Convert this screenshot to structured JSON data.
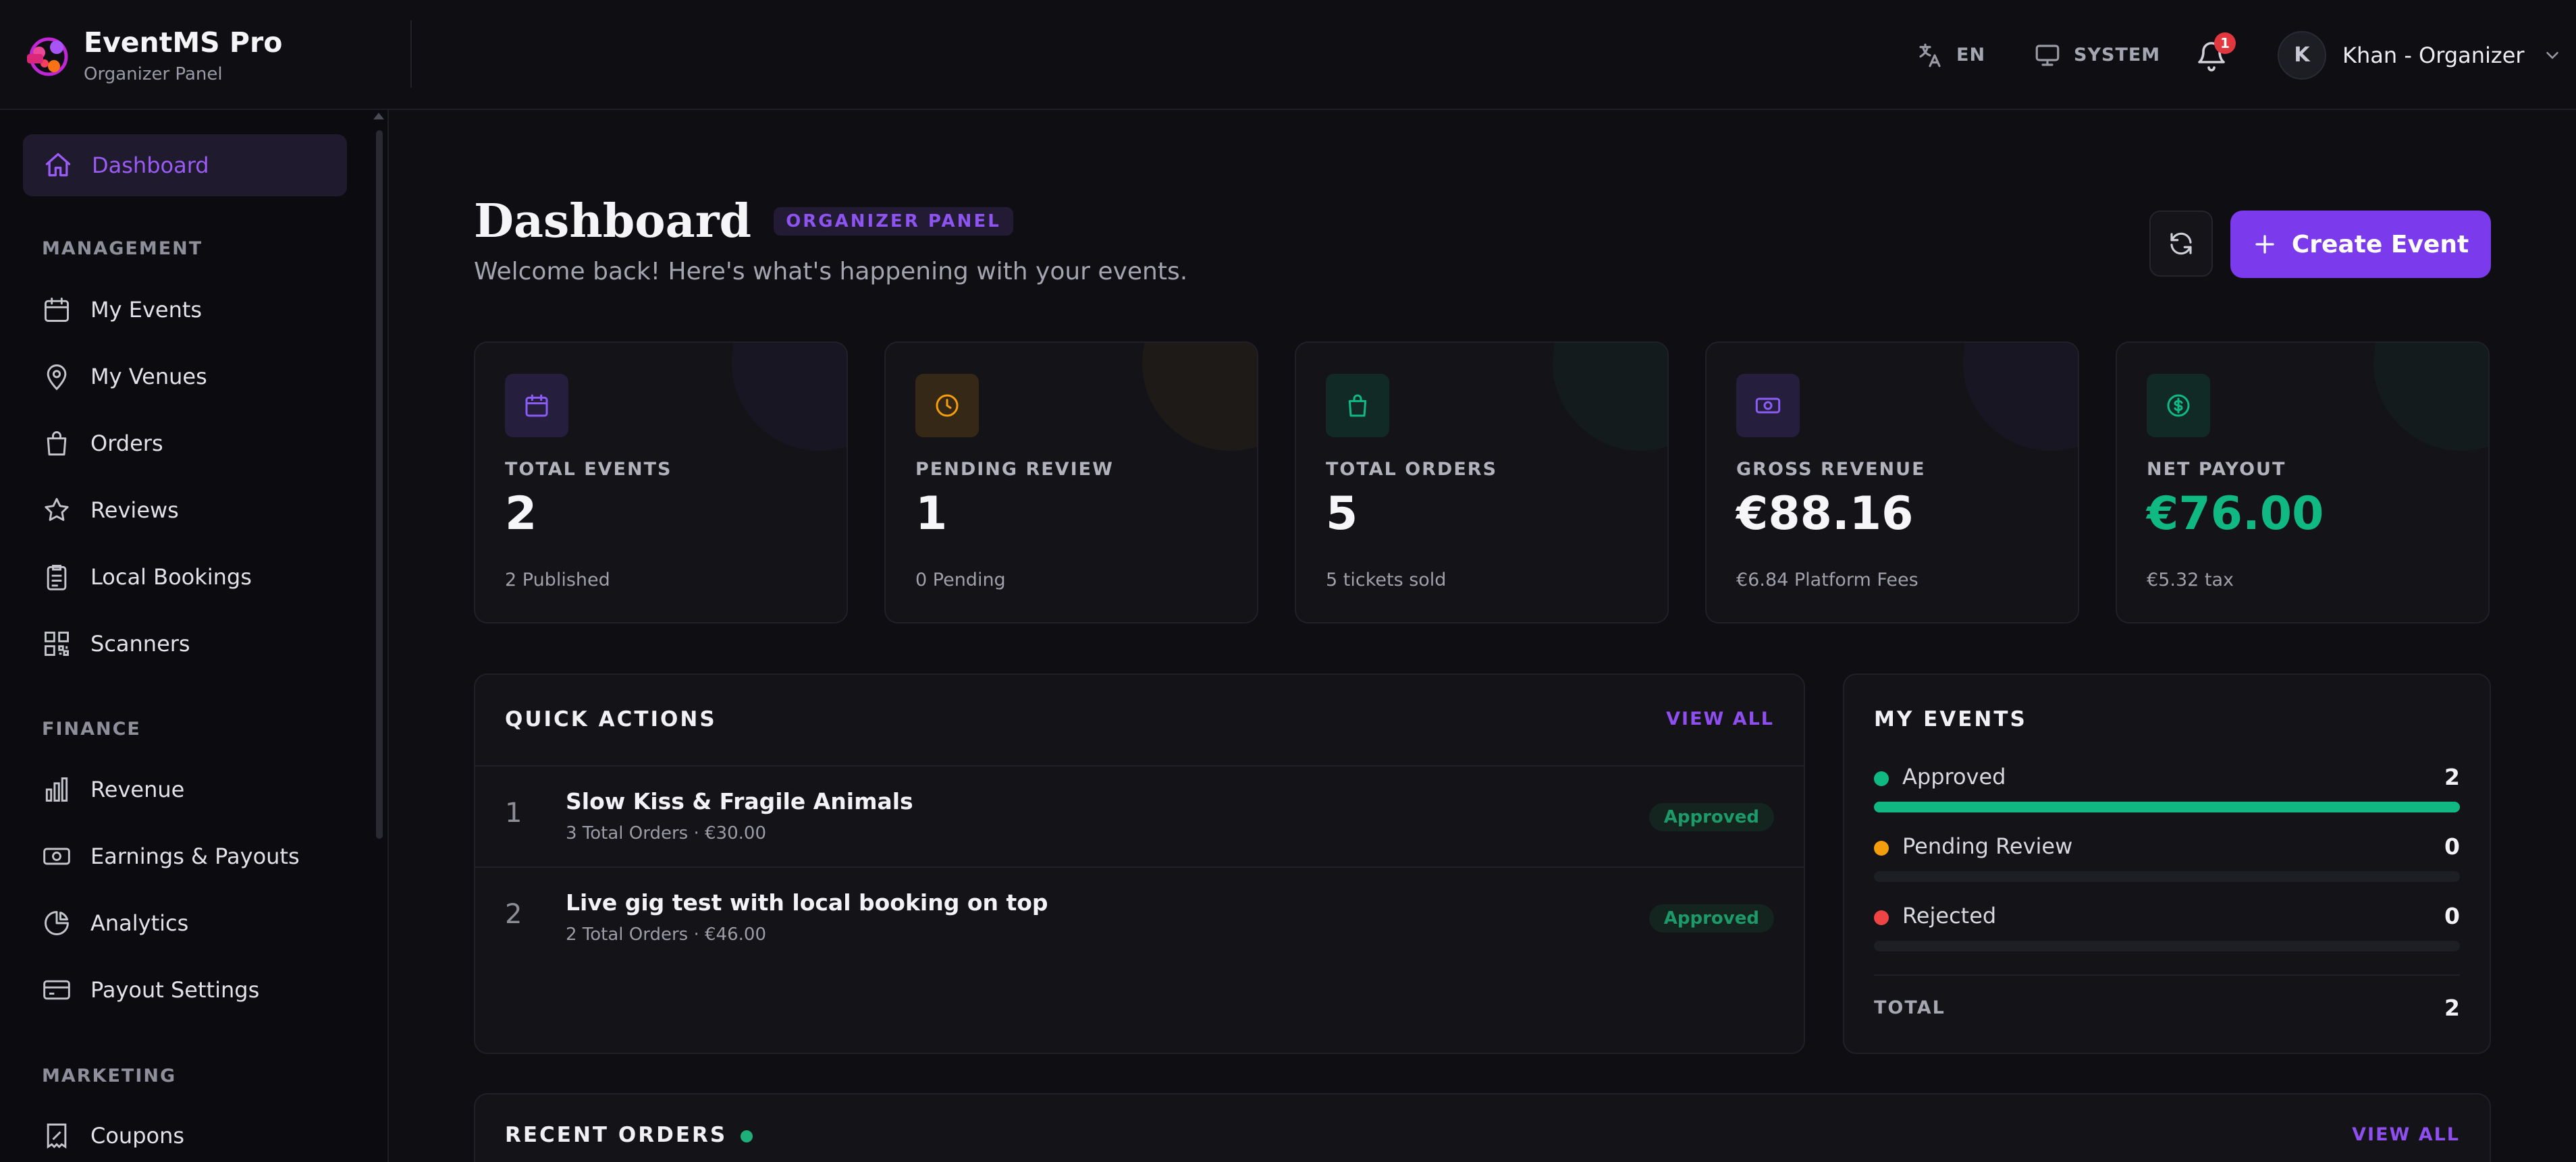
{
  "brand": {
    "title": "EventMS Pro",
    "subtitle": "Organizer Panel"
  },
  "topbar": {
    "language": "EN",
    "theme": "SYSTEM",
    "notifications_count": "1",
    "user_initial": "K",
    "user_name": "Khan - Organizer"
  },
  "sidebar": {
    "dashboard": "Dashboard",
    "management_title": "MANAGEMENT",
    "management": [
      "My Events",
      "My Venues",
      "Orders",
      "Reviews",
      "Local Bookings",
      "Scanners"
    ],
    "finance_title": "FINANCE",
    "finance": [
      "Revenue",
      "Earnings & Payouts",
      "Analytics",
      "Payout Settings"
    ],
    "marketing_title": "MARKETING",
    "marketing": [
      "Coupons"
    ]
  },
  "header": {
    "title": "Dashboard",
    "badge": "ORGANIZER PANEL",
    "subtitle": "Welcome back! Here's what's happening with your events.",
    "create_label": "Create Event"
  },
  "stats": [
    {
      "label": "TOTAL EVENTS",
      "value": "2",
      "sub": "2 Published",
      "icon": "calendar-icon",
      "color": "#8b5cf6"
    },
    {
      "label": "PENDING REVIEW",
      "value": "1",
      "sub": "0 Pending",
      "icon": "clock-icon",
      "color": "#f59e0b"
    },
    {
      "label": "TOTAL ORDERS",
      "value": "5",
      "sub": "5 tickets sold",
      "icon": "shopping-bag-icon",
      "color": "#10b981"
    },
    {
      "label": "GROSS REVENUE",
      "value": "€88.16",
      "sub": "€6.84 Platform Fees",
      "icon": "banknote-icon",
      "color": "#8b5cf6"
    },
    {
      "label": "NET PAYOUT",
      "value": "€76.00",
      "sub": "€5.32 tax",
      "icon": "dollar-circle-icon",
      "color": "#10b981"
    }
  ],
  "quick_actions": {
    "title": "QUICK ACTIONS",
    "view_all": "VIEW ALL",
    "items": [
      {
        "num": "1",
        "title": "Slow Kiss & Fragile Animals",
        "meta": "3 Total Orders · €30.00",
        "status": "Approved"
      },
      {
        "num": "2",
        "title": "Live gig test with local booking on top",
        "meta": "2 Total Orders · €46.00",
        "status": "Approved"
      }
    ]
  },
  "my_events": {
    "title": "MY EVENTS",
    "rows": [
      {
        "label": "Approved",
        "count": "2",
        "fraction": 1.0,
        "color": "#10b981"
      },
      {
        "label": "Pending Review",
        "count": "0",
        "fraction": 0.0,
        "color": "#f59e0b"
      },
      {
        "label": "Rejected",
        "count": "0",
        "fraction": 0.0,
        "color": "#ef4444"
      }
    ],
    "total_label": "TOTAL",
    "total_value": "2"
  },
  "recent_orders": {
    "title": "RECENT ORDERS",
    "view_all": "VIEW ALL"
  },
  "colors": {
    "accent": "#7c3aed",
    "success": "#10b981",
    "warning": "#f59e0b",
    "danger": "#ef4444"
  }
}
